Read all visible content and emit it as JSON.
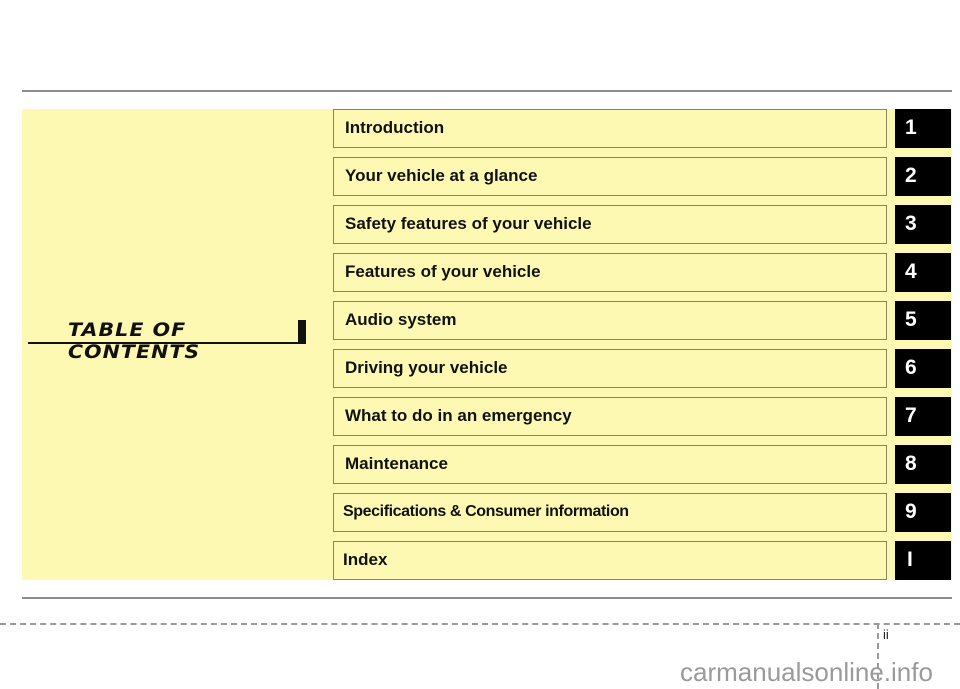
{
  "title": "TABLE OF CONTENTS",
  "sections": [
    {
      "label": "Introduction",
      "tab": "1"
    },
    {
      "label": "Your vehicle at a glance",
      "tab": "2"
    },
    {
      "label": "Safety features of your vehicle",
      "tab": "3"
    },
    {
      "label": "Features of your vehicle",
      "tab": "4"
    },
    {
      "label": "Audio system",
      "tab": "5"
    },
    {
      "label": "Driving your vehicle",
      "tab": "6"
    },
    {
      "label": "What to do in an emergency",
      "tab": "7"
    },
    {
      "label": "Maintenance",
      "tab": "8"
    },
    {
      "label": "Specifications & Consumer information",
      "tab": "9"
    },
    {
      "label": "Index",
      "tab": "I"
    }
  ],
  "footer": {
    "page_number": "ii",
    "watermark": "carmanualsonline.info"
  },
  "colors": {
    "panel": "#fef9b2",
    "tab": "#000000",
    "tab_text": "#ffffff"
  }
}
